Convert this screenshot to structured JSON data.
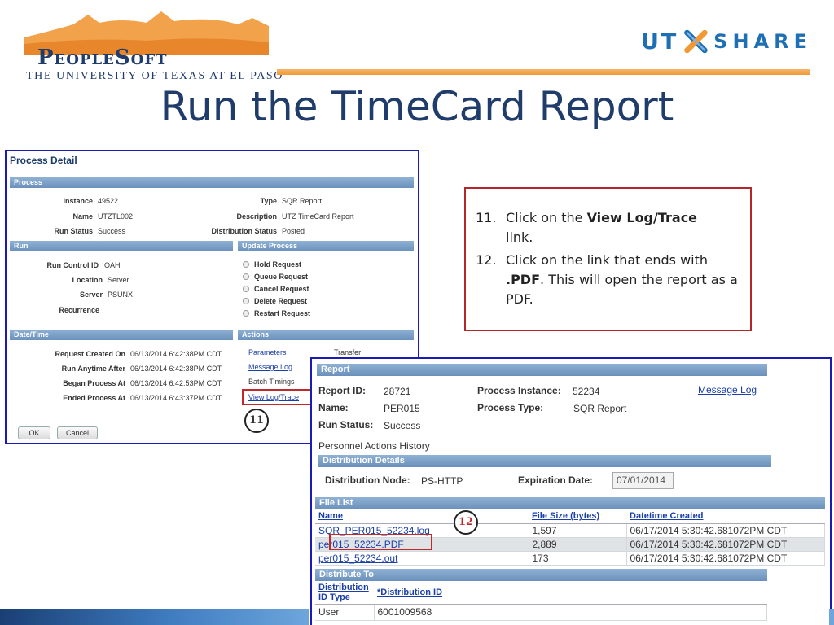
{
  "header": {
    "brand": "PeopleSoft",
    "brand_subtitle": "THE UNIVERSITY OF TEXAS AT EL PASO",
    "logo_right_a": "UT",
    "logo_right_b": "SHARE",
    "title": "Run the TimeCard Report"
  },
  "process_detail": {
    "title": "Process Detail",
    "process_section": "Process",
    "instance_label": "Instance",
    "instance_value": "49522",
    "type_label": "Type",
    "type_value": "SQR Report",
    "name_label": "Name",
    "name_value": "UTZTL002",
    "description_label": "Description",
    "description_value": "UTZ TimeCard Report",
    "run_status_label": "Run Status",
    "run_status_value": "Success",
    "dist_status_label": "Distribution Status",
    "dist_status_value": "Posted",
    "run_section": "Run",
    "update_section": "Update Process",
    "run_control_label": "Run Control ID",
    "run_control_value": "OAH",
    "location_label": "Location",
    "location_value": "Server",
    "server_label": "Server",
    "server_value": "PSUNX",
    "recurrence_label": "Recurrence",
    "update_options": [
      "Hold Request",
      "Queue Request",
      "Cancel Request",
      "Delete Request",
      "Restart Request"
    ],
    "datetime_section": "Date/Time",
    "actions_section": "Actions",
    "request_created_label": "Request Created On",
    "request_created_value": "06/13/2014  6:42:38PM CDT",
    "run_anytime_label": "Run Anytime After",
    "run_anytime_value": "06/13/2014  6:42:38PM CDT",
    "began_label": "Began Process At",
    "began_value": "06/13/2014  6:42:53PM CDT",
    "ended_label": "Ended Process At",
    "ended_value": "06/13/2014  6:43:37PM CDT",
    "action_parameters": "Parameters",
    "action_transfer": "Transfer",
    "action_message_log": "Message Log",
    "action_batch_timings": "Batch Timings",
    "action_view_log": "View Log/Trace",
    "ok_button": "OK",
    "cancel_button": "Cancel",
    "step_marker": "11"
  },
  "callout": {
    "step11_num": "11.",
    "step11_a": "Click on the ",
    "step11_bold": "View Log/Trace",
    "step11_b": " link.",
    "step12_num": "12.",
    "step12_a": "Click on the link that ends with ",
    "step12_bold": ".PDF",
    "step12_b": ". This will open the report as a PDF."
  },
  "report": {
    "section_title": "Report",
    "report_id_label": "Report ID:",
    "report_id_value": "28721",
    "process_instance_label": "Process Instance:",
    "process_instance_value": "52234",
    "message_log_link": "Message Log",
    "name_label": "Name:",
    "name_value": "PER015",
    "process_type_label": "Process Type:",
    "process_type_value": "SQR Report",
    "run_status_label": "Run Status:",
    "run_status_value": "Success",
    "description": "Personnel Actions History",
    "distribution_details": "Distribution Details",
    "dist_node_label": "Distribution Node:",
    "dist_node_value": "PS-HTTP",
    "expiration_label": "Expiration Date:",
    "expiration_value": "07/01/2014",
    "file_list_title": "File List",
    "file_columns": [
      "Name",
      "File Size (bytes)",
      "Datetime Created"
    ],
    "files": [
      {
        "name": "SQR_PER015_52234.log",
        "size": "1,597",
        "created": "06/17/2014  5:30:42.681072PM CDT"
      },
      {
        "name": "per015_52234.PDF",
        "size": "2,889",
        "created": "06/17/2014  5:30:42.681072PM CDT"
      },
      {
        "name": "per015_52234.out",
        "size": "173",
        "created": "06/17/2014  5:30:42.681072PM CDT"
      }
    ],
    "distribute_to_title": "Distribute To",
    "dist_columns": [
      "Distribution ID Type",
      "*Distribution ID"
    ],
    "dist_rows": [
      {
        "type": "User",
        "id": "6001009568"
      }
    ],
    "step_marker": "12"
  },
  "colors": {
    "title_blue": "#1f3c6b",
    "callout_border": "#b3262a",
    "screenshot_border": "#1a1ab8",
    "accent_orange": "#f19a35"
  }
}
